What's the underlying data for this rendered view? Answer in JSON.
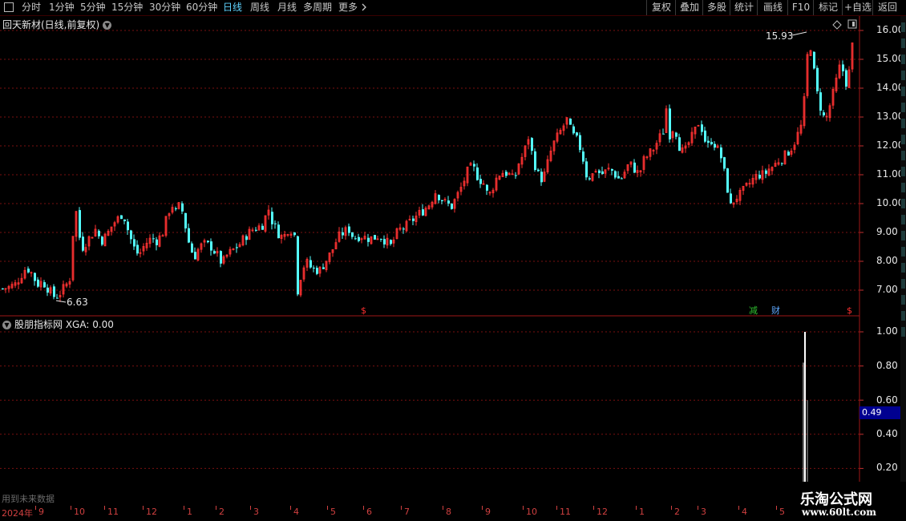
{
  "toolbar": {
    "periods": [
      "分时",
      "1分钟",
      "5分钟",
      "15分钟",
      "30分钟",
      "60分钟",
      "日线",
      "周线",
      "月线",
      "多周期",
      "更多"
    ],
    "active_period": "日线",
    "more_icon": "chevron-right-icon",
    "buttons": [
      "复权",
      "叠加",
      "多股",
      "统计",
      "画线",
      "F10",
      "标记",
      "+自选",
      "返回"
    ]
  },
  "main": {
    "title": "回天新材(日线,前复权)",
    "title_icon": "chevron-down-icon",
    "high_label": "15.93",
    "low_label": "6.63",
    "axis_labels": [
      "16.00",
      "15.00",
      "14.00",
      "13.00",
      "12.00",
      "11.00",
      "10.00",
      "9.00",
      "8.00",
      "7.00"
    ],
    "markers": [
      {
        "text": "$",
        "color": "#ff3030"
      },
      {
        "text": "减",
        "color": "#30c030"
      },
      {
        "text": "财",
        "color": "#5fa8ff"
      },
      {
        "text": "$",
        "color": "#ff3030"
      }
    ]
  },
  "indicator": {
    "title": "股朋指标网  XGA: 0.00",
    "title_icon": "chevron-down-icon",
    "axis_labels": [
      "1.00",
      "0.80",
      "0.60",
      "0.40",
      "0.20"
    ],
    "current_value": "0.49",
    "warning": "用到未来数据"
  },
  "date_axis": [
    "2024年",
    "9",
    "10",
    "11",
    "12",
    "1",
    "2",
    "3",
    "4",
    "5",
    "6",
    "7",
    "8",
    "9",
    "10",
    "11",
    "12",
    "1",
    "2",
    "3",
    "4",
    "5"
  ],
  "branding": {
    "name": "乐淘公式网",
    "url": "www.60lt.com"
  },
  "colors": {
    "up": "#ff3232",
    "down": "#54ffff",
    "grid": "#7a1010",
    "background": "#000000",
    "active": "#5fd3ff"
  },
  "chart_data": {
    "type": "candlestick",
    "title": "回天新材(日线,前复权)",
    "ylim": [
      6.4,
      16.4
    ],
    "points": [
      [
        0,
        7.05
      ],
      [
        10,
        7.1
      ],
      [
        18,
        7.2
      ],
      [
        25,
        7.5
      ],
      [
        32,
        7.8
      ],
      [
        38,
        7.6
      ],
      [
        45,
        7.2
      ],
      [
        52,
        7.3
      ],
      [
        60,
        7.0
      ],
      [
        67,
        6.75
      ],
      [
        74,
        6.9
      ],
      [
        82,
        7.2
      ],
      [
        88,
        7.5
      ],
      [
        92,
        10.4
      ],
      [
        96,
        9.0
      ],
      [
        102,
        8.5
      ],
      [
        110,
        8.8
      ],
      [
        118,
        9.1
      ],
      [
        125,
        8.7
      ],
      [
        132,
        8.9
      ],
      [
        140,
        9.3
      ],
      [
        147,
        9.5
      ],
      [
        152,
        9.7
      ],
      [
        158,
        9.1
      ],
      [
        165,
        8.5
      ],
      [
        172,
        8.2
      ],
      [
        180,
        8.6
      ],
      [
        188,
        8.8
      ],
      [
        195,
        8.7
      ],
      [
        202,
        9.0
      ],
      [
        208,
        9.6
      ],
      [
        213,
        10.0
      ],
      [
        218,
        9.7
      ],
      [
        224,
        10.0
      ],
      [
        230,
        9.2
      ],
      [
        236,
        8.4
      ],
      [
        242,
        8.2
      ],
      [
        248,
        8.5
      ],
      [
        255,
        8.6
      ],
      [
        262,
        8.5
      ],
      [
        270,
        8.2
      ],
      [
        276,
        7.9
      ],
      [
        282,
        8.2
      ],
      [
        290,
        8.4
      ],
      [
        298,
        8.6
      ],
      [
        306,
        8.9
      ],
      [
        314,
        9.1
      ],
      [
        322,
        9.2
      ],
      [
        328,
        9.3
      ],
      [
        333,
        9.9
      ],
      [
        338,
        9.4
      ],
      [
        345,
        9.0
      ],
      [
        352,
        8.8
      ],
      [
        360,
        9.2
      ],
      [
        366,
        8.9
      ],
      [
        370,
        7.0
      ],
      [
        375,
        7.6
      ],
      [
        380,
        8.0
      ],
      [
        386,
        7.8
      ],
      [
        392,
        7.7
      ],
      [
        398,
        7.7
      ],
      [
        405,
        8.0
      ],
      [
        412,
        8.3
      ],
      [
        420,
        8.8
      ],
      [
        427,
        9.0
      ],
      [
        434,
        9.1
      ],
      [
        440,
        8.8
      ],
      [
        448,
        8.9
      ],
      [
        456,
        8.8
      ],
      [
        464,
        8.8
      ],
      [
        472,
        8.9
      ],
      [
        480,
        8.7
      ],
      [
        487,
        8.5
      ],
      [
        492,
        8.9
      ],
      [
        498,
        9.1
      ],
      [
        505,
        9.2
      ],
      [
        512,
        9.4
      ],
      [
        520,
        9.6
      ],
      [
        528,
        9.8
      ],
      [
        535,
        10.0
      ],
      [
        542,
        10.4
      ],
      [
        548,
        10.2
      ],
      [
        555,
        10.0
      ],
      [
        562,
        9.9
      ],
      [
        568,
        10.2
      ],
      [
        575,
        10.6
      ],
      [
        582,
        11.1
      ],
      [
        588,
        11.3
      ],
      [
        595,
        10.9
      ],
      [
        602,
        10.7
      ],
      [
        608,
        10.2
      ],
      [
        614,
        10.6
      ],
      [
        620,
        11.0
      ],
      [
        627,
        11.1
      ],
      [
        634,
        11.0
      ],
      [
        640,
        10.8
      ],
      [
        646,
        11.4
      ],
      [
        652,
        11.7
      ],
      [
        658,
        12.3
      ],
      [
        664,
        11.5
      ],
      [
        670,
        11.0
      ],
      [
        676,
        10.8
      ],
      [
        682,
        11.4
      ],
      [
        688,
        12.0
      ],
      [
        694,
        12.3
      ],
      [
        700,
        12.6
      ],
      [
        706,
        12.9
      ],
      [
        712,
        12.4
      ],
      [
        718,
        12.2
      ],
      [
        724,
        11.8
      ],
      [
        730,
        11.0
      ],
      [
        736,
        10.9
      ],
      [
        742,
        11.2
      ],
      [
        748,
        11.0
      ],
      [
        754,
        11.1
      ],
      [
        760,
        11.2
      ],
      [
        766,
        11.0
      ],
      [
        772,
        10.8
      ],
      [
        778,
        11.1
      ],
      [
        784,
        11.4
      ],
      [
        790,
        11.2
      ],
      [
        796,
        11.0
      ],
      [
        802,
        11.5
      ],
      [
        808,
        11.7
      ],
      [
        814,
        11.9
      ],
      [
        820,
        12.2
      ],
      [
        826,
        12.5
      ],
      [
        830,
        13.3
      ],
      [
        834,
        12.4
      ],
      [
        840,
        12.7
      ],
      [
        846,
        12.0
      ],
      [
        852,
        11.7
      ],
      [
        858,
        12.1
      ],
      [
        864,
        12.4
      ],
      [
        870,
        12.8
      ],
      [
        876,
        12.5
      ],
      [
        880,
        11.9
      ],
      [
        886,
        12.2
      ],
      [
        892,
        12.0
      ],
      [
        898,
        11.6
      ],
      [
        904,
        10.8
      ],
      [
        910,
        9.9
      ],
      [
        916,
        10.2
      ],
      [
        922,
        10.3
      ],
      [
        928,
        10.5
      ],
      [
        934,
        10.7
      ],
      [
        940,
        10.9
      ],
      [
        946,
        11.0
      ],
      [
        952,
        11.0
      ],
      [
        958,
        11.2
      ],
      [
        964,
        11.3
      ],
      [
        970,
        11.5
      ],
      [
        976,
        11.6
      ],
      [
        982,
        11.8
      ],
      [
        988,
        12.0
      ],
      [
        994,
        12.4
      ],
      [
        1000,
        12.8
      ],
      [
        1004,
        14.3
      ],
      [
        1008,
        15.9
      ],
      [
        1012,
        15.0
      ],
      [
        1016,
        14.1
      ],
      [
        1020,
        13.5
      ],
      [
        1024,
        13.2
      ],
      [
        1028,
        12.8
      ],
      [
        1032,
        13.2
      ],
      [
        1036,
        13.6
      ],
      [
        1040,
        14.0
      ],
      [
        1044,
        14.5
      ],
      [
        1048,
        14.9
      ],
      [
        1052,
        14.3
      ],
      [
        1056,
        14.1
      ],
      [
        1060,
        15.0
      ],
      [
        1063,
        15.7
      ]
    ],
    "indicator_signal": {
      "position": 1004,
      "value": 1.0
    }
  }
}
